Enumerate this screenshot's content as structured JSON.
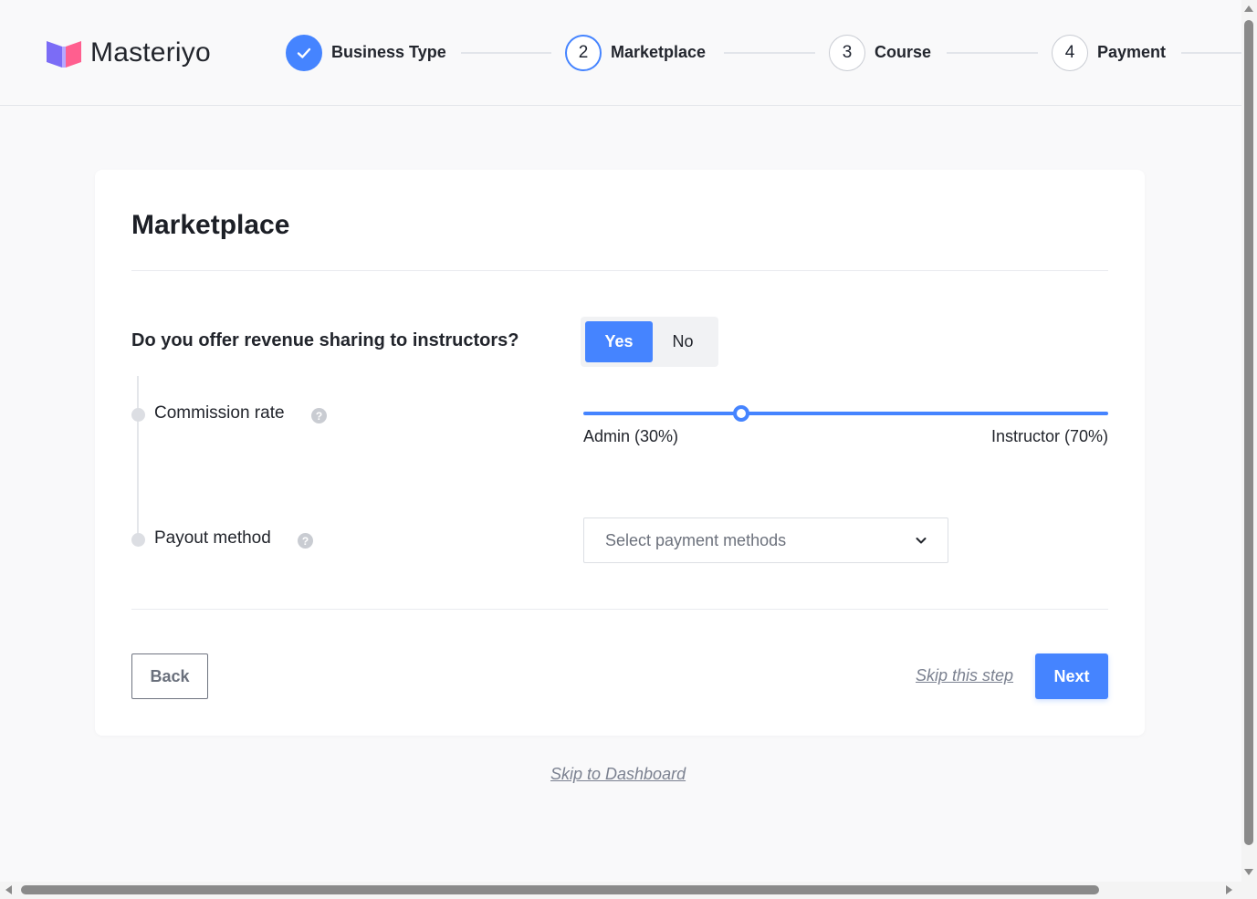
{
  "brand": {
    "name": "Masteriyo"
  },
  "steps": [
    {
      "number": "",
      "label": "Business Type",
      "state": "done",
      "icon": "check-icon"
    },
    {
      "number": "2",
      "label": "Marketplace",
      "state": "active"
    },
    {
      "number": "3",
      "label": "Course",
      "state": "pending"
    },
    {
      "number": "4",
      "label": "Payment",
      "state": "pending"
    }
  ],
  "card": {
    "title": "Marketplace",
    "question": "Do you offer revenue sharing to instructors?",
    "toggle": {
      "yes": "Yes",
      "no": "No",
      "selected": "Yes"
    },
    "commission": {
      "label": "Commission rate",
      "help": "?",
      "admin_label": "Admin (30%)",
      "instructor_label": "Instructor (70%)",
      "admin_share": 0.3
    },
    "payout": {
      "label": "Payout method",
      "help": "?",
      "placeholder": "Select payment methods"
    },
    "actions": {
      "back": "Back",
      "skip": "Skip this step",
      "next": "Next"
    }
  },
  "footer": {
    "skip_dashboard": "Skip to Dashboard"
  },
  "colors": {
    "accent": "#4584ff",
    "text": "#22252c",
    "muted": "#7b8190"
  }
}
